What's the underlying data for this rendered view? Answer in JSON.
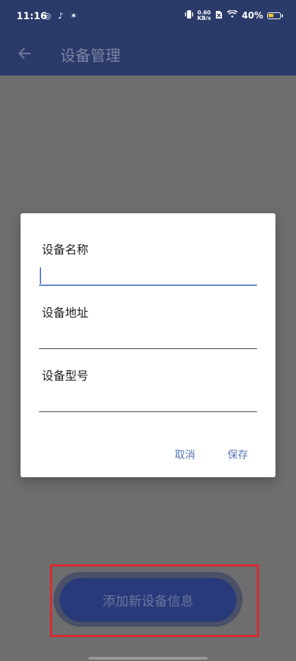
{
  "status_bar": {
    "time": "11:16",
    "notification_icons": "◎ ♪ ✶",
    "net_speed_value": "0.60",
    "net_speed_unit": "KB/s",
    "battery_percent": "40%",
    "battery_level": 0.4
  },
  "app_bar": {
    "title": "设备管理",
    "back_icon": "arrow-left-icon"
  },
  "dialog": {
    "fields": [
      {
        "label": "设备名称",
        "value": "",
        "focused": true
      },
      {
        "label": "设备地址",
        "value": ""
      },
      {
        "label": "设备型号",
        "value": ""
      }
    ],
    "cancel_label": "取消",
    "save_label": "保存"
  },
  "main": {
    "add_button_label": "添加新设备信息"
  },
  "colors": {
    "primary": "#2a3a69",
    "accent": "#5b7fc6",
    "highlight_box": "#e0262e",
    "scrim": "#6e6e6e"
  }
}
